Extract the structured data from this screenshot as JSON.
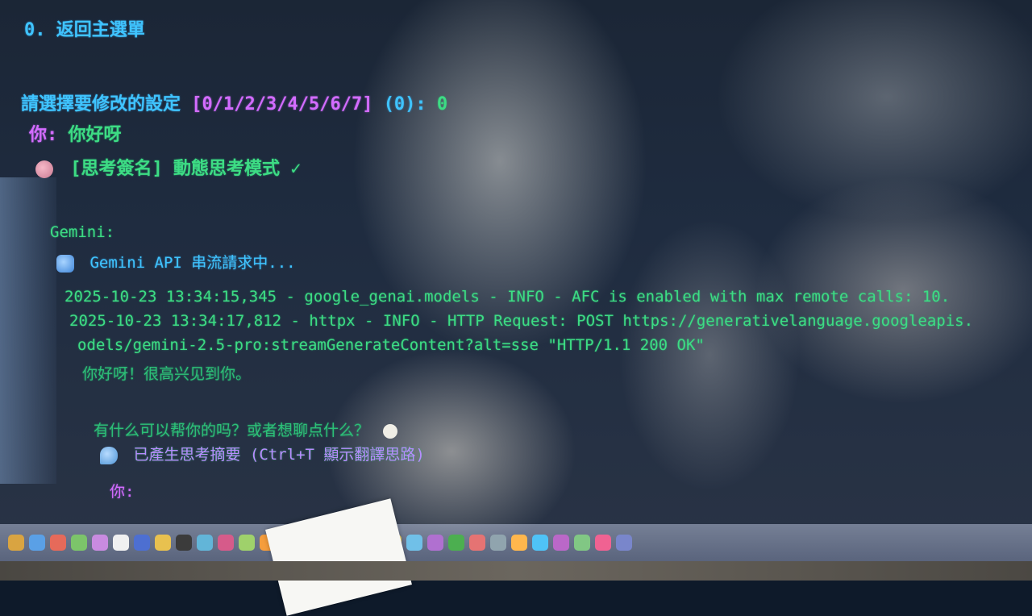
{
  "terminal": {
    "menu_return": "0. 返回主選單",
    "prompt_settings_label": "請選擇要修改的設定",
    "prompt_settings_options": "[0/1/2/3/4/5/6/7]",
    "prompt_settings_default": "(0):",
    "prompt_settings_value": "0",
    "user1_label": "你:",
    "user1_message": "你好呀",
    "thinking_signature": "[思考簽名] 動態思考模式 ✓",
    "model_label": "Gemini:",
    "streaming_status": "Gemini API 串流請求中...",
    "log1": "2025-10-23 13:34:15,345 - google_genai.models - INFO - AFC is enabled with max remote calls: 10.",
    "log2": "2025-10-23 13:34:17,812 - httpx - INFO - HTTP Request: POST https://generativelanguage.googleapis.",
    "log3": "odels/gemini-2.5-pro:streamGenerateContent?alt=sse \"HTTP/1.1 200 OK\"",
    "reply1": "你好呀！很高兴见到你。",
    "reply2": "有什么可以帮你的吗？或者想聊点什么？",
    "summary_notice": "已產生思考摘要 (Ctrl+T 顯示翻譯思路)",
    "user2_label": "你:"
  },
  "icons": {
    "thinking": "brain-icon",
    "streaming": "refresh-icon",
    "summary": "speech-bubble-icon",
    "reply_emoji": "moon-icon"
  },
  "colors": {
    "terminal_green": "#3ddc84",
    "prompt_cyan": "#3fc4ff",
    "prompt_magenta": "#d36cff"
  }
}
